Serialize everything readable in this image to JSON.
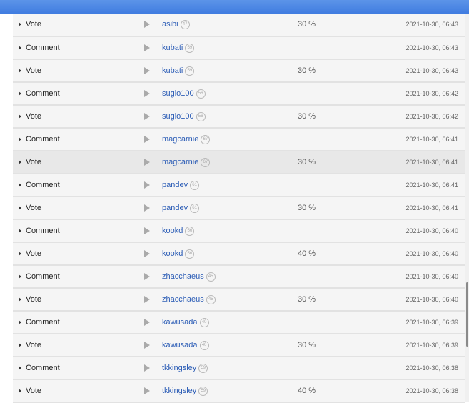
{
  "rows": [
    {
      "type": "Vote",
      "user": "asibi",
      "level": "47",
      "percent": "30 %",
      "time": "2021-10-30, 06:43"
    },
    {
      "type": "Comment",
      "user": "kubati",
      "level": "59",
      "percent": "",
      "time": "2021-10-30, 06:43"
    },
    {
      "type": "Vote",
      "user": "kubati",
      "level": "59",
      "percent": "30 %",
      "time": "2021-10-30, 06:43"
    },
    {
      "type": "Comment",
      "user": "suglo100",
      "level": "56",
      "percent": "",
      "time": "2021-10-30, 06:42"
    },
    {
      "type": "Vote",
      "user": "suglo100",
      "level": "56",
      "percent": "30 %",
      "time": "2021-10-30, 06:42"
    },
    {
      "type": "Comment",
      "user": "magcarnie",
      "level": "67",
      "percent": "",
      "time": "2021-10-30, 06:41"
    },
    {
      "type": "Vote",
      "user": "magcarnie",
      "level": "67",
      "percent": "30 %",
      "time": "2021-10-30, 06:41"
    },
    {
      "type": "Comment",
      "user": "pandev",
      "level": "61",
      "percent": "",
      "time": "2021-10-30, 06:41"
    },
    {
      "type": "Vote",
      "user": "pandev",
      "level": "61",
      "percent": "30 %",
      "time": "2021-10-30, 06:41"
    },
    {
      "type": "Comment",
      "user": "kookd",
      "level": "56",
      "percent": "",
      "time": "2021-10-30, 06:40"
    },
    {
      "type": "Vote",
      "user": "kookd",
      "level": "56",
      "percent": "40 %",
      "time": "2021-10-30, 06:40"
    },
    {
      "type": "Comment",
      "user": "zhacchaeus",
      "level": "45",
      "percent": "",
      "time": "2021-10-30, 06:40"
    },
    {
      "type": "Vote",
      "user": "zhacchaeus",
      "level": "45",
      "percent": "30 %",
      "time": "2021-10-30, 06:40"
    },
    {
      "type": "Comment",
      "user": "kawusada",
      "level": "40",
      "percent": "",
      "time": "2021-10-30, 06:39"
    },
    {
      "type": "Vote",
      "user": "kawusada",
      "level": "40",
      "percent": "30 %",
      "time": "2021-10-30, 06:39"
    },
    {
      "type": "Comment",
      "user": "tkkingsley",
      "level": "59",
      "percent": "",
      "time": "2021-10-30, 06:38"
    },
    {
      "type": "Vote",
      "user": "tkkingsley",
      "level": "59",
      "percent": "40 %",
      "time": "2021-10-30, 06:38"
    }
  ],
  "icons": {
    "expand": "caret-right-icon",
    "play": "play-icon",
    "level": "level-badge-icon"
  },
  "colors": {
    "header": "#4a86e6",
    "username": "#2c5db6",
    "highlighted_row": "#e8e8e8"
  },
  "highlighted_row_index": 6
}
